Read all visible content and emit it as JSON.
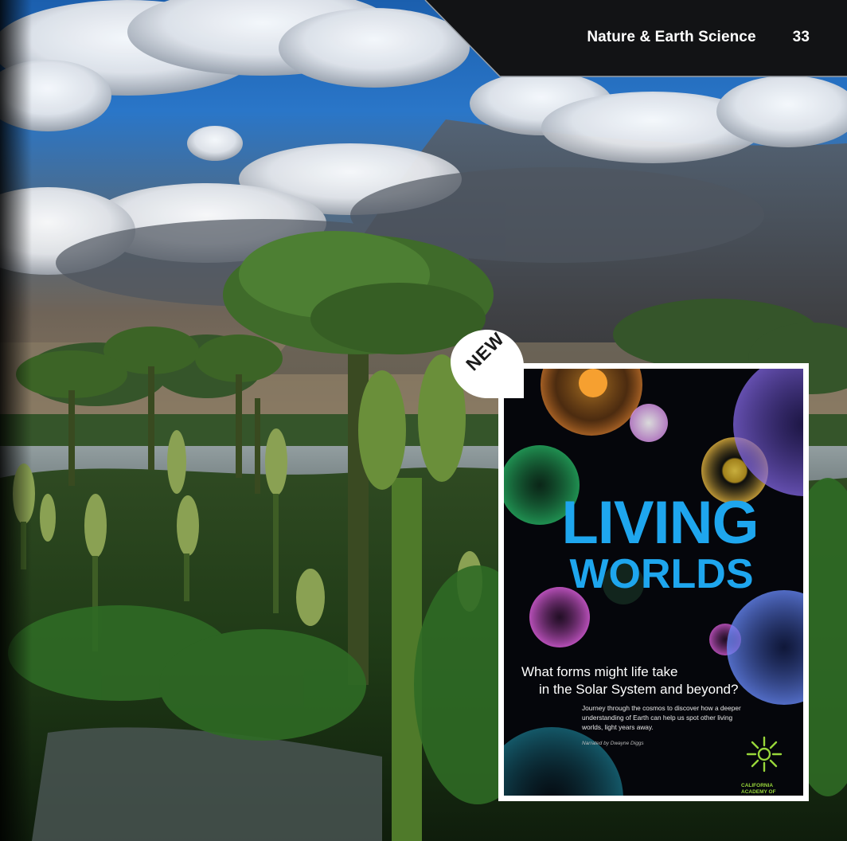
{
  "header": {
    "section_title": "Nature & Earth Science",
    "page_number": "33"
  },
  "badge": {
    "label": "NEW"
  },
  "poster": {
    "title_line1": "LIVING",
    "title_line2": "WORLDS",
    "question_line1": "What forms might life take",
    "question_line2": "in the Solar System and beyond?",
    "blurb": "Journey through the cosmos to discover how a deeper understanding of Earth can help us spot other living worlds, light years away.",
    "credit": "Narrated by Dwayne Diggs",
    "logo_text": "CALIFORNIA ACADEMY OF"
  },
  "colors": {
    "title_blue": "#1ea6ee",
    "header_bg": "#121315",
    "logo_green": "#98d63a"
  }
}
